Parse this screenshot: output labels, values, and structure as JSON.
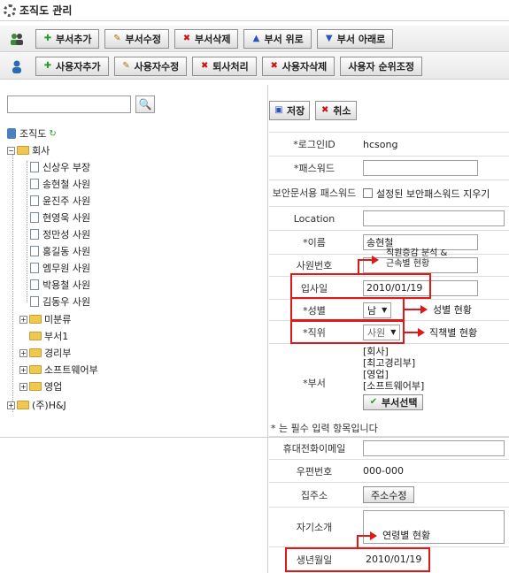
{
  "title": "조직도 관리",
  "toolbar1": {
    "add_dept": "부서추가",
    "edit_dept": "부서수정",
    "delete_dept": "부서삭제",
    "dept_up": "부서 위로",
    "dept_down": "부서 아래로"
  },
  "toolbar2": {
    "add_user": "사용자추가",
    "edit_user": "사용자수정",
    "retire": "퇴사처리",
    "delete_user": "사용자삭제",
    "reorder_user": "사용자 순위조정"
  },
  "tree": {
    "root": "조직도",
    "company": "회사",
    "people": [
      "신상우 부장",
      "송현철 사원",
      "윤진주 사원",
      "현영욱 사원",
      "정만성 사원",
      "홍길동 사원",
      "엠무원 사원",
      "박용철 사원",
      "김동우 사원"
    ],
    "unclassified": "미분류",
    "dept1": "부서1",
    "accounting": "경리부",
    "software": "소프트웨어부",
    "sales": "영업",
    "other_company": "(주)H&J"
  },
  "form": {
    "save": "저장",
    "cancel": "취소",
    "login_id_label": "*로그인ID",
    "login_id_value": "hcsong",
    "password_label": "*패스워드",
    "secure_pw_label": "보안문서용 패스워드",
    "secure_pw_check": "설정된 보안패스워드 지우기",
    "location_label": "Location",
    "name_label": "*이름",
    "name_value": "송현철",
    "emp_no_label": "사원번호",
    "hire_label": "입사일",
    "hire_value": "2010/01/19",
    "gender_label": "*성별",
    "gender_value": "남",
    "position_label": "*직위",
    "position_value": "사원",
    "dept_label": "*부서",
    "dept_values": [
      "[회사]",
      "[최고경리부]",
      "[영업]",
      "[소프트웨어부]"
    ],
    "dept_select": "부서선택",
    "required_note": "* 는 필수 입력 항목입니다",
    "mobile_email_label": "휴대전화이메일",
    "zip_label": "우편번호",
    "zip_value": "000-000",
    "address_label": "집주소",
    "address_btn": "주소수정",
    "intro_label": "자기소개",
    "birth_label": "생년월일",
    "birth_value": "2010/01/19"
  },
  "annotations": {
    "a1": "직원증감 분석 &",
    "a1b": "근속별 현황",
    "a2": "성별 현황",
    "a3": "직책별 현황",
    "a4": "연령별 현황"
  }
}
